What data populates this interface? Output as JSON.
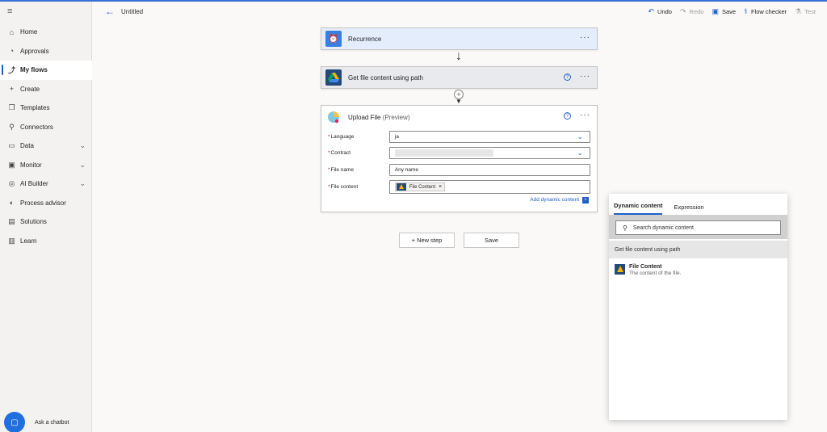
{
  "header": {
    "title": "Untitled",
    "actions": [
      {
        "label": "Undo",
        "icon": "undo-icon",
        "enabled": true
      },
      {
        "label": "Redo",
        "icon": "redo-icon",
        "enabled": false
      },
      {
        "label": "Save",
        "icon": "save-icon",
        "enabled": true
      },
      {
        "label": "Flow checker",
        "icon": "stethoscope-icon",
        "enabled": true
      },
      {
        "label": "Test",
        "icon": "flask-icon",
        "enabled": false
      }
    ]
  },
  "sidebar": {
    "items": [
      {
        "label": "Home",
        "icon": "home-icon"
      },
      {
        "label": "Approvals",
        "icon": "approvals-icon"
      },
      {
        "label": "My flows",
        "icon": "flow-icon",
        "active": true
      },
      {
        "label": "Create",
        "icon": "plus-icon"
      },
      {
        "label": "Templates",
        "icon": "templates-icon"
      },
      {
        "label": "Connectors",
        "icon": "connectors-icon"
      },
      {
        "label": "Data",
        "icon": "data-icon",
        "expandable": true
      },
      {
        "label": "Monitor",
        "icon": "monitor-icon",
        "expandable": true
      },
      {
        "label": "AI Builder",
        "icon": "ai-builder-icon",
        "expandable": true
      },
      {
        "label": "Process advisor",
        "icon": "process-advisor-icon"
      },
      {
        "label": "Solutions",
        "icon": "solutions-icon"
      },
      {
        "label": "Learn",
        "icon": "learn-icon"
      }
    ],
    "chatbot_label": "Ask a chatbot"
  },
  "flow": {
    "recurrence": {
      "title": "Recurrence",
      "color": "#3a7fe0"
    },
    "gdrive": {
      "title": "Get file content using path"
    },
    "upload": {
      "title": "Upload File",
      "title_suffix": "(Preview)",
      "fields": {
        "language": {
          "label": "Language",
          "value": "ja"
        },
        "contract": {
          "label": "Contract",
          "value": ""
        },
        "file_name": {
          "label": "File name",
          "value": "Any name"
        },
        "file_content": {
          "label": "File content",
          "token": "File Content"
        }
      },
      "add_dynamic": "Add dynamic content"
    },
    "new_step_label": "+ New step",
    "save_label": "Save"
  },
  "dynamic_panel": {
    "tabs": [
      "Dynamic content",
      "Expression"
    ],
    "search_placeholder": "Search dynamic content",
    "section": "Get file content using path",
    "items": [
      {
        "name": "File Content",
        "desc": "The content of the file."
      }
    ]
  },
  "colors": {
    "accent": "#1f5fc9"
  }
}
